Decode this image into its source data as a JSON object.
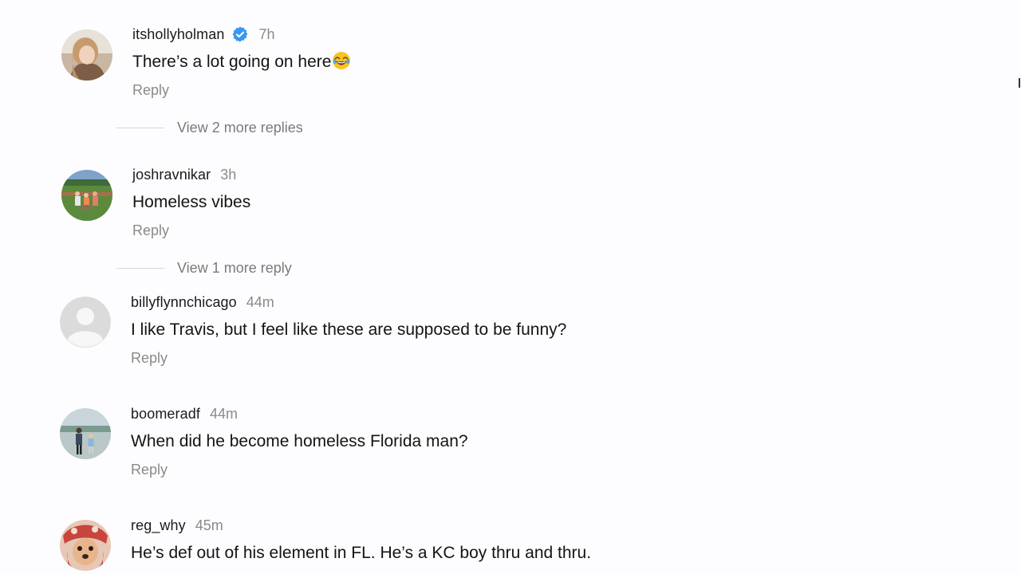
{
  "comments": [
    {
      "username": "itshollyholman",
      "verified": true,
      "time": "7h",
      "text": "There’s a lot going on here",
      "emoji": "face-with-tears-of-joy",
      "reply_label": "Reply",
      "view_more_label": "View 2 more replies"
    },
    {
      "username": "joshravnikar",
      "verified": false,
      "time": "3h",
      "text": "Homeless vibes",
      "reply_label": "Reply",
      "view_more_label": "View 1 more reply"
    },
    {
      "username": "billyflynnchicago",
      "verified": false,
      "time": "44m",
      "text": "I like Travis, but I feel like these are supposed to be funny?",
      "reply_label": "Reply"
    },
    {
      "username": "boomeradf",
      "verified": false,
      "time": "44m",
      "text": "When did he become homeless Florida man?",
      "reply_label": "Reply"
    },
    {
      "username": "reg_why",
      "verified": false,
      "time": "45m",
      "text": "He’s def out of his element in FL. He’s a KC boy thru and thru."
    }
  ],
  "colors": {
    "verified_badge": "#3897f0",
    "muted_text": "#8a8a8a",
    "background": "#fdfdff"
  }
}
